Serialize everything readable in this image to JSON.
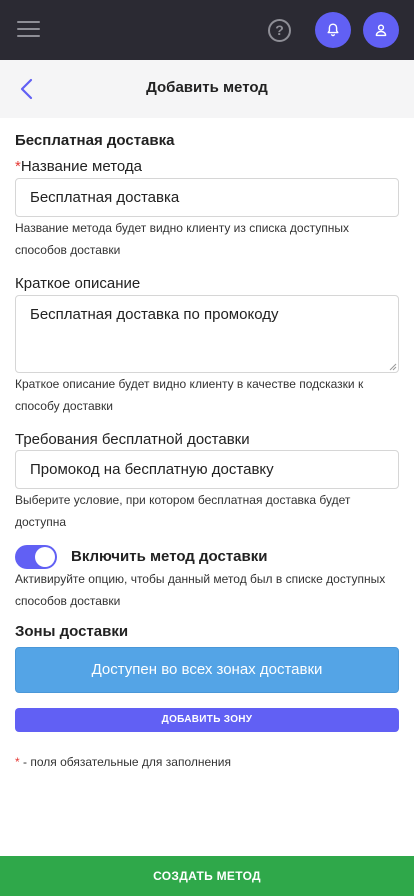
{
  "header": {
    "menu_icon": "hamburger-icon",
    "help_icon": "help-icon",
    "help_glyph": "?",
    "notifications_icon": "bell-icon",
    "profile_icon": "user-icon",
    "accent_color": "#6160f4",
    "background_color": "#2b2a33"
  },
  "subheader": {
    "back_icon": "chevron-left-icon",
    "title": "Добавить метод"
  },
  "form": {
    "section_title": "Бесплатная доставка",
    "required_mark": "*",
    "method_name": {
      "label": "Название метода",
      "value": "Бесплатная доставка",
      "help": "Название метода будет видно клиенту из списка доступных способов доставки"
    },
    "short_description": {
      "label": "Краткое описание",
      "value": "Бесплатная доставка по промокоду",
      "help": "Краткое описание будет видно клиенту в качестве подсказки к способу доставки"
    },
    "requirements": {
      "label": "Требования бесплатной доставки",
      "value": "Промокод на бесплатную доставку",
      "help": "Выберите условие, при котором бесплатная доставка будет доступна"
    },
    "enable_method": {
      "label": "Включить метод доставки",
      "enabled": true,
      "help": "Активируйте опцию, чтобы данный метод был в списке доступных способов доставки"
    },
    "zones": {
      "title": "Зоны доставки",
      "available_text": "Доступен во всех зонах доставки",
      "add_button": "ДОБАВИТЬ ЗОНУ"
    },
    "footnote": "- поля обязательные для заполнения"
  },
  "footer": {
    "create_button": "СОЗДАТЬ МЕТОД",
    "color": "#2fa84a"
  }
}
